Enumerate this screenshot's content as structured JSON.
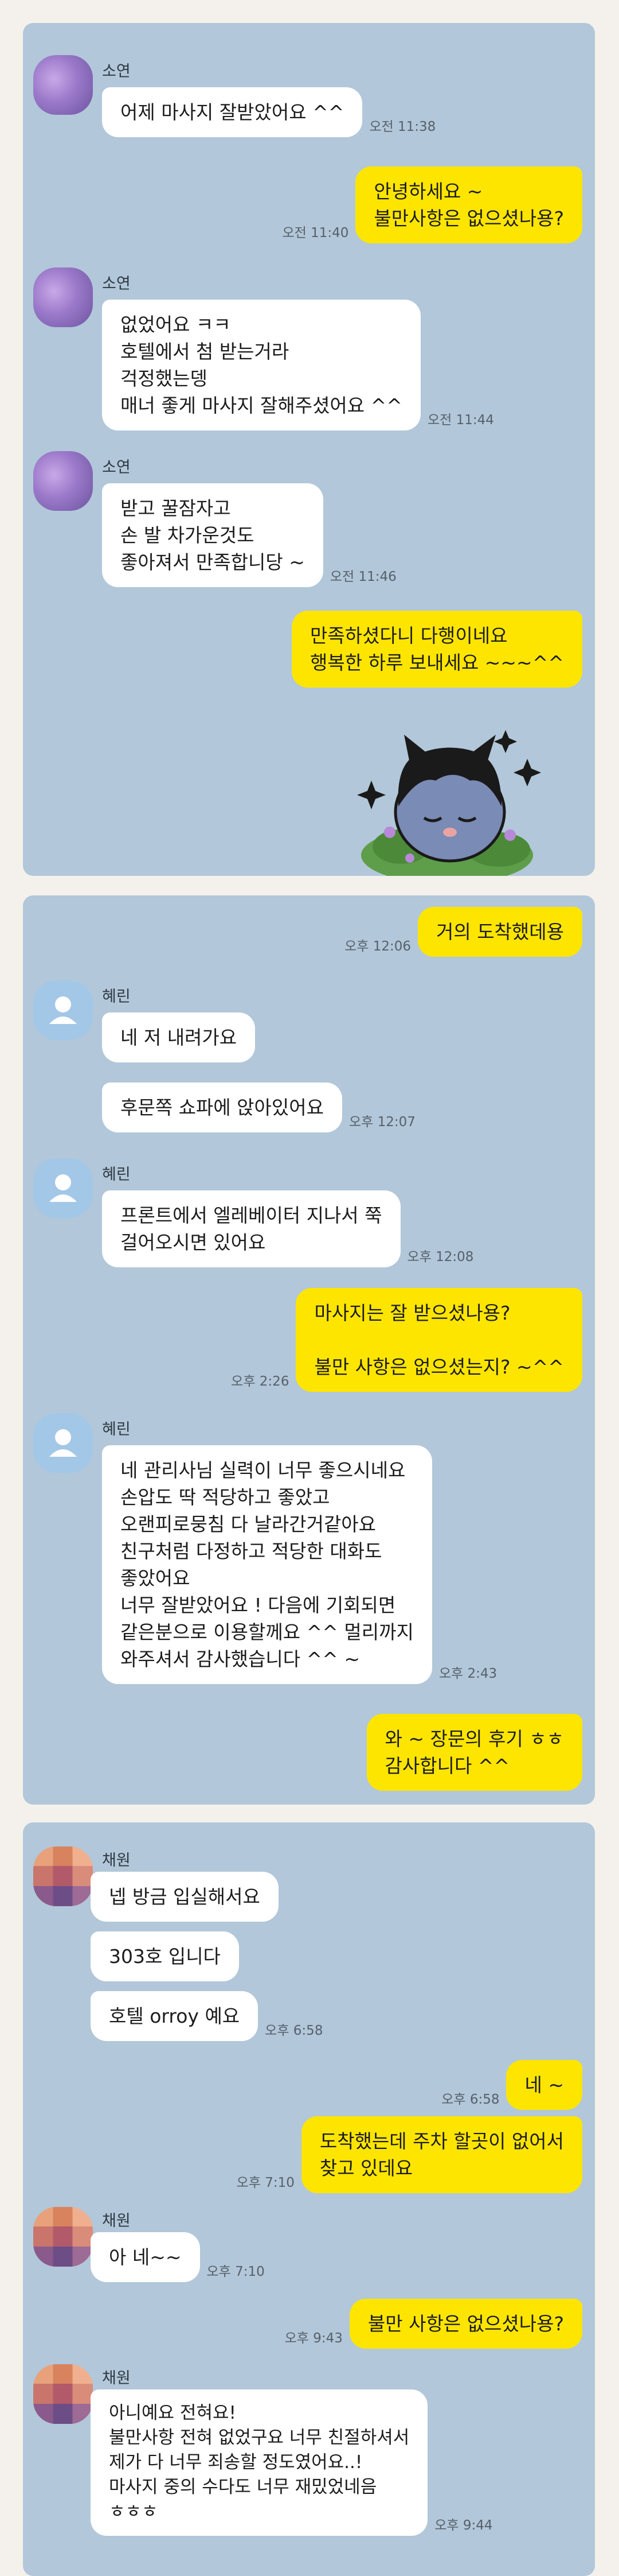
{
  "panel1": {
    "contact_name": "소연",
    "messages": [
      {
        "text": "어제 마사지 잘받았어요 ^^",
        "time": "오전 11:38"
      },
      {
        "text": "안녕하세요 ~\n불만사항은 없으셨나용?",
        "time": "오전 11:40"
      },
      {
        "text": "없었어요 ㅋㅋ\n호텔에서 첨 받는거라\n걱정했는뎅\n매너 좋게 마사지 잘해주셨어요 ^^",
        "time": "오전 11:44"
      },
      {
        "text": "받고 꿀잠자고\n손 발 차가운것도\n좋아져서 만족합니당 ~",
        "time": "오전 11:46"
      },
      {
        "text": "만족하셨다니 다행이네요\n행복한 하루 보내세요 ~~~^^",
        "time": ""
      }
    ]
  },
  "panel2": {
    "contact_name": "혜린",
    "messages": [
      {
        "text": "거의 도착했데용",
        "time": "오후 12:06"
      },
      {
        "text": "네 저 내려가요",
        "time": ""
      },
      {
        "text": "후문쪽 쇼파에 앉아있어요",
        "time": "오후 12:07"
      },
      {
        "text": "프론트에서 엘레베이터 지나서 쭉\n걸어오시면 있어요",
        "time": "오후 12:08"
      },
      {
        "text": "마사지는 잘 받으셨나용?\n\n불만 사항은 없으셨는지? ~^^",
        "time": "오후 2:26"
      },
      {
        "text": "네 관리사님 실력이 너무 좋으시네요\n손압도 딱 적당하고 좋았고\n오랜피로뭉침 다 날라간거같아요\n친구처럼 다정하고 적당한 대화도\n좋았어요\n너무 잘받았어요 ! 다음에 기회되면\n같은분으로 이용할께요 ^^ 멀리까지\n와주셔서 감사했습니다 ^^ ~",
        "time": "오후 2:43"
      },
      {
        "text": "와 ~ 장문의 후기 ㅎㅎ\n감사합니다 ^^",
        "time": ""
      }
    ]
  },
  "panel3": {
    "contact_name": "채원",
    "messages": [
      {
        "text": "넵 방금 입실해서요",
        "time": ""
      },
      {
        "text": "303호 입니다",
        "time": ""
      },
      {
        "text": "호텔 orroy 예요",
        "time": "오후 6:58"
      },
      {
        "text": "네 ~",
        "time": "오후 6:58"
      },
      {
        "text": "도착했는데  주차 할곳이 없어서\n찾고 있데요",
        "time": "오후 7:10"
      },
      {
        "text": "아 네~~",
        "time": "오후 7:10"
      },
      {
        "text": "불만 사항은 없으셨나용?",
        "time": "오후 9:43"
      },
      {
        "text": "아니예요 전혀요!\n불만사항 전혀 없었구요 너무 친절하셔서\n제가 다 너무 죄송할 정도였어요..!\n마사지 중의 수다도 너무 재밌었네음\nㅎㅎㅎ",
        "time": "오후 9:44"
      }
    ]
  },
  "colors": {
    "chat_bg": "#b2c7d9",
    "outgoing_bubble": "#fee500",
    "incoming_bubble": "#ffffff"
  }
}
